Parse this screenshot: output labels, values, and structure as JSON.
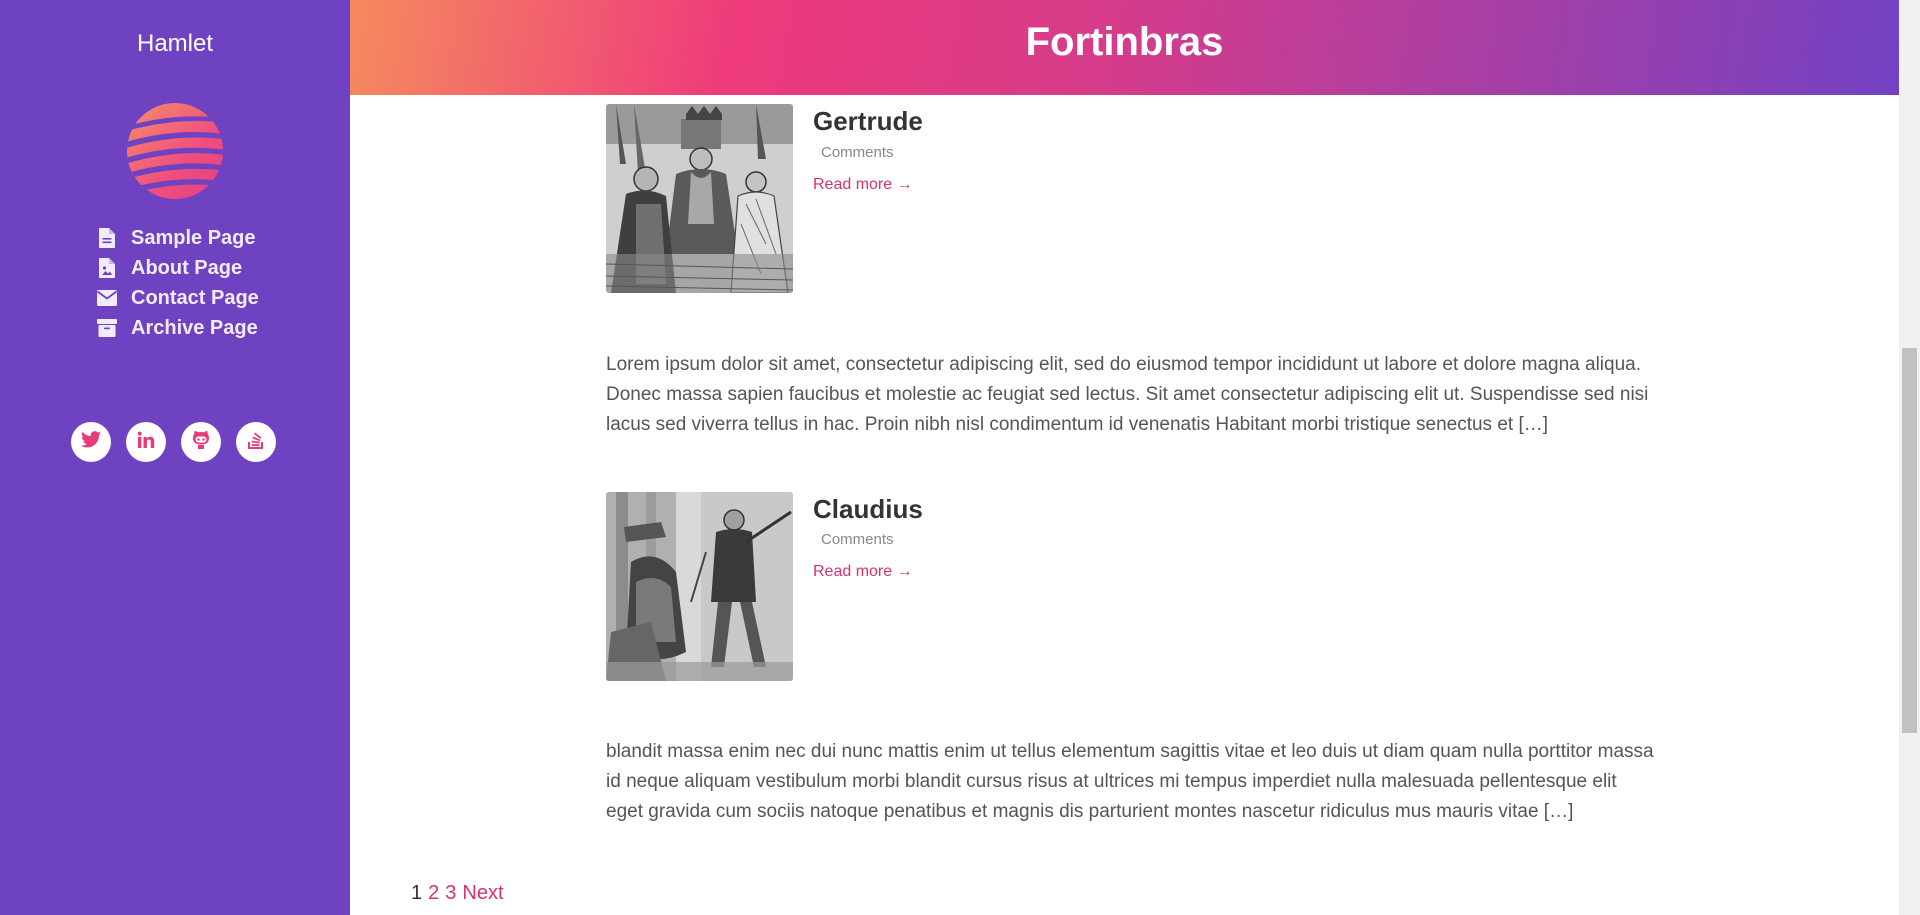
{
  "sidebar": {
    "site_title": "Hamlet",
    "nav": [
      {
        "label": "Sample Page",
        "icon": "file-icon"
      },
      {
        "label": "About Page",
        "icon": "file-image-icon"
      },
      {
        "label": "Contact Page",
        "icon": "envelope-icon"
      },
      {
        "label": "Archive Page",
        "icon": "archive-icon"
      }
    ],
    "social": [
      {
        "icon": "twitter-icon"
      },
      {
        "icon": "linkedin-icon"
      },
      {
        "icon": "github-icon"
      },
      {
        "icon": "stackoverflow-icon"
      }
    ]
  },
  "header": {
    "title": "Fortinbras"
  },
  "posts": [
    {
      "title": "Gertrude",
      "comments": "Comments",
      "read_more": "Read more →",
      "excerpt": "Lorem ipsum dolor sit amet, consectetur adipiscing elit, sed do eiusmod tempor incididunt ut labore et dolore magna aliqua. Donec massa sapien faucibus et molestie ac feugiat sed lectus. Sit amet consectetur adipiscing elit ut. Suspendisse sed nisi lacus sed viverra tellus in hac. Proin nibh nisl condimentum id venenatis Habitant morbi tristique senectus et […]"
    },
    {
      "title": "Claudius",
      "comments": "Comments",
      "read_more": "Read more →",
      "excerpt": "blandit massa enim nec dui nunc mattis enim ut tellus elementum sagittis vitae et leo duis ut diam quam nulla porttitor massa id neque aliquam vestibulum morbi blandit cursus risus at ultrices mi tempus imperdiet nulla malesuada pellentesque elit eget gravida cum sociis natoque penatibus et magnis dis parturient montes nascetur ridiculus mus mauris vitae […]"
    }
  ],
  "pagination": {
    "current": "1",
    "pages": [
      "2",
      "3"
    ],
    "next": "Next"
  },
  "colors": {
    "sidebar_bg": "#6f42c1",
    "accent": "#d6336c",
    "header_gradient_start": "#f58b5e",
    "header_gradient_end": "#7242c3"
  }
}
